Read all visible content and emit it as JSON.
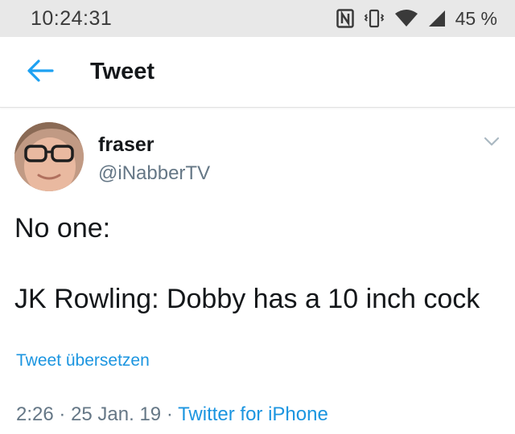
{
  "status_bar": {
    "time": "10:24:31",
    "battery": "45 %",
    "icons": [
      "nfc-icon",
      "vibrate-icon",
      "wifi-icon",
      "signal-icon"
    ]
  },
  "app_bar": {
    "back_icon": "arrow-left-icon",
    "title": "Tweet",
    "accent_color": "#1da1f2"
  },
  "tweet": {
    "author": {
      "display_name": "fraser",
      "handle": "@iNabberTV",
      "avatar": "avatar"
    },
    "text_lines": [
      "No one:",
      "JK Rowling: Dobby has a 10 inch cock"
    ],
    "translate_label": "Tweet übersetzen",
    "time": "2:26",
    "date": "25 Jan. 19",
    "separator": "·",
    "source": "Twitter for iPhone",
    "link_color": "#1b95e0"
  }
}
